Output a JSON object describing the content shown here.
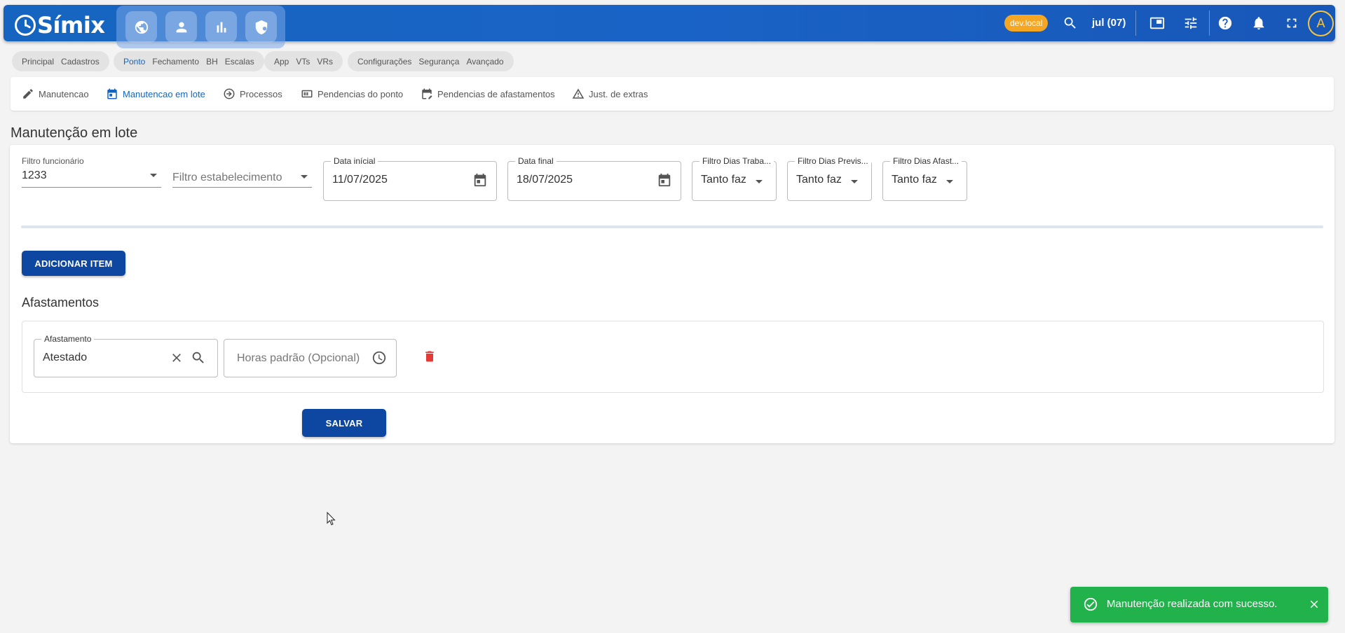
{
  "app": {
    "name": "Símix"
  },
  "header": {
    "modules": [
      {
        "icon": "globe-icon"
      },
      {
        "icon": "person-icon"
      },
      {
        "icon": "bar-chart-icon"
      },
      {
        "icon": "shield-icon"
      }
    ],
    "env_badge": "dev.local",
    "date_label": "jul (07)",
    "avatar_letter": "A",
    "brand_color": "#1565c0",
    "env_color": "#f5a623"
  },
  "chip_groups": [
    {
      "items": [
        "Principal",
        "Cadastros"
      ]
    },
    {
      "items": [
        "Ponto",
        "Fechamento",
        "BH",
        "Escalas"
      ],
      "active": "Ponto"
    },
    {
      "items": [
        "App",
        "VTs",
        "VRs"
      ]
    },
    {
      "items": [
        "Configurações",
        "Segurança",
        "Avançado"
      ]
    }
  ],
  "tabs": [
    {
      "label": "Manutencao",
      "icon": "pencil-icon"
    },
    {
      "label": "Manutencao em lote",
      "icon": "calendar-icon",
      "active": true
    },
    {
      "label": "Processos",
      "icon": "arrow-circle-icon"
    },
    {
      "label": "Pendencias do ponto",
      "icon": "card-icon"
    },
    {
      "label": "Pendencias de afastamentos",
      "icon": "calendar-edit-icon"
    },
    {
      "label": "Just. de extras",
      "icon": "warning-icon"
    }
  ],
  "page": {
    "title": "Manutenção em lote"
  },
  "filters": {
    "funcionario": {
      "label": "Filtro funcionário",
      "value": "1233"
    },
    "estabelecimento": {
      "placeholder": "Filtro estabelecimento"
    },
    "data_inicial": {
      "label": "Data inícial",
      "value": "11/07/2025"
    },
    "data_final": {
      "label": "Data final",
      "value": "18/07/2025"
    },
    "dias_trabalhados": {
      "label": "Filtro Dias Traba...",
      "value": "Tanto faz"
    },
    "dias_previstos": {
      "label": "Filtro Dias Previs...",
      "value": "Tanto faz"
    },
    "dias_afastamento": {
      "label": "Filtro Dias Afast...",
      "value": "Tanto faz"
    }
  },
  "actions": {
    "add_item": "ADICIONAR ITEM",
    "save": "SALVAR"
  },
  "afastamentos": {
    "title": "Afastamentos",
    "afastamento": {
      "label": "Afastamento",
      "value": "Atestado"
    },
    "horas_padrao": {
      "placeholder": "Horas padrão (Opcional)"
    }
  },
  "toast": {
    "message": "Manutenção realizada com sucesso.",
    "color": "#21b24b"
  }
}
